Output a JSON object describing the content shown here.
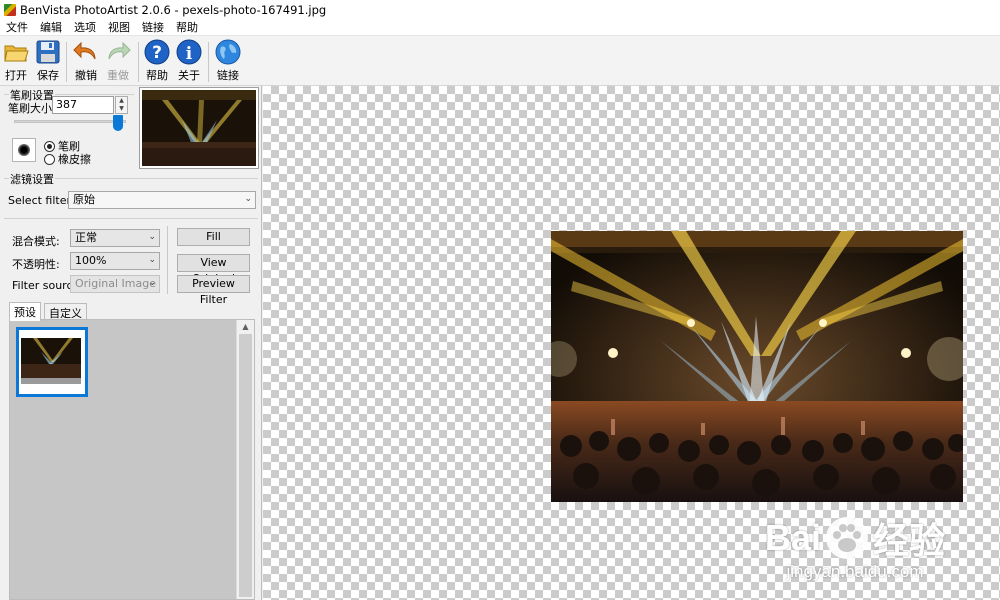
{
  "window": {
    "title": "BenVista PhotoArtist 2.0.6 - pexels-photo-167491.jpg"
  },
  "menu": [
    "文件",
    "编辑",
    "选项",
    "视图",
    "链接",
    "帮助"
  ],
  "toolbar": {
    "open": "打开",
    "save": "保存",
    "undo": "撤销",
    "redo": "重做",
    "help": "帮助",
    "about": "关于",
    "link": "链接"
  },
  "brush_settings": {
    "group_title": "笔刷设置",
    "size_label": "笔刷大小:",
    "size_value": "387",
    "slider_fraction": 0.93,
    "mode_brush": "笔刷",
    "mode_eraser": "橡皮擦",
    "selected_mode": "笔刷"
  },
  "filter_settings": {
    "group_title": "滤镜设置",
    "select_filter_label": "Select filter:",
    "selected_filter": "原始",
    "blend_mode_label": "混合模式:",
    "blend_mode_value": "正常",
    "opacity_label": "不透明性:",
    "opacity_value": "100%",
    "filter_source_label": "Filter source:",
    "filter_source_value": "Original Image",
    "fill_button": "Fill",
    "view_original_button": "View Original",
    "preview_filter_button": "Preview Filter"
  },
  "preset_tabs": {
    "tabs": [
      "预设",
      "自定义"
    ],
    "active_tab": "预设"
  },
  "watermark": {
    "brand_left": "Bai",
    "brand_right": "经验",
    "url": "jingyan.baidu.com"
  },
  "colors": {
    "accent": "#0a78d7",
    "checker_dark": "#cbcbcb",
    "checker_light": "#ffffff"
  }
}
